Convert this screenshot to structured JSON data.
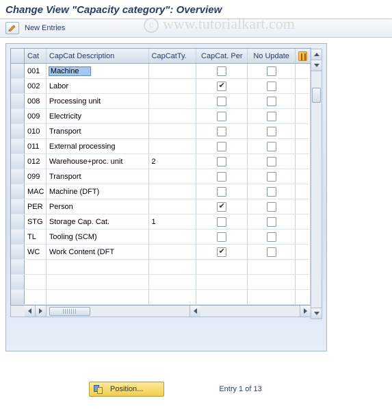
{
  "title": "Change View \"Capacity category\": Overview",
  "toolbar": {
    "new_entries": "New Entries"
  },
  "watermark": "www.tutorialkart.com",
  "table": {
    "headers": {
      "cat": "Cat",
      "desc": "CapCat Description",
      "ty": "CapCatTy.",
      "per": "CapCat. Per",
      "upd": "No Update"
    },
    "rows": [
      {
        "cat": "001",
        "desc": "Machine",
        "ty": "",
        "per": false,
        "upd": false,
        "hl": true
      },
      {
        "cat": "002",
        "desc": "Labor",
        "ty": "",
        "per": true,
        "upd": false
      },
      {
        "cat": "008",
        "desc": "Processing unit",
        "ty": "",
        "per": false,
        "upd": false
      },
      {
        "cat": "009",
        "desc": "Electricity",
        "ty": "",
        "per": false,
        "upd": false
      },
      {
        "cat": "010",
        "desc": "Transport",
        "ty": "",
        "per": false,
        "upd": false
      },
      {
        "cat": "011",
        "desc": "External processing",
        "ty": "",
        "per": false,
        "upd": false
      },
      {
        "cat": "012",
        "desc": "Warehouse+proc. unit",
        "ty": "2",
        "per": false,
        "upd": false
      },
      {
        "cat": "099",
        "desc": "Transport",
        "ty": "",
        "per": false,
        "upd": false
      },
      {
        "cat": "MAC",
        "desc": "Machine (DFT)",
        "ty": "",
        "per": false,
        "upd": false
      },
      {
        "cat": "PER",
        "desc": "Person",
        "ty": "",
        "per": true,
        "upd": false
      },
      {
        "cat": "STG",
        "desc": "Storage Cap. Cat.",
        "ty": "1",
        "per": false,
        "upd": false
      },
      {
        "cat": "TL",
        "desc": "Tooling (SCM)",
        "ty": "",
        "per": false,
        "upd": false
      },
      {
        "cat": "WC",
        "desc": "Work Content (DFT",
        "ty": "",
        "per": true,
        "upd": false
      }
    ],
    "empty_rows": 3
  },
  "footer": {
    "position_label": "Position...",
    "entry_text": "Entry 1 of 13"
  }
}
